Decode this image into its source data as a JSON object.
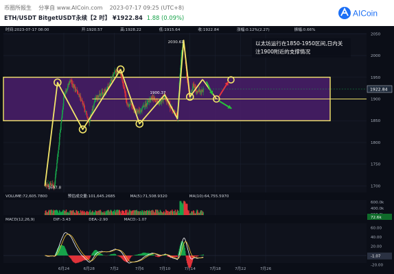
{
  "header": {
    "source": "币圈所报生",
    "share": "分享自 www.AICoin.com",
    "datetime": "2023-07-17 09:25 (UTC+8)",
    "pair": "ETH/USDT BitgetUSDT永续【2 时】",
    "price": "¥1922.84",
    "change": "1.88 (0.09%)",
    "brand": "AICoin"
  },
  "colors": {
    "up": "#17a34a",
    "down": "#e0333a",
    "annotation": "#f4e66a",
    "zone_fill": "#4a1e6b",
    "current_price": "#1f2a3a"
  },
  "ohlc_bar": [
    "时间:2023-07-17 08:00",
    "开:1920.57",
    "高:1928.22",
    "低:1915.64",
    "收:1922.84",
    "涨幅:0.12%(2.27)",
    "振幅:0.66%"
  ],
  "chart_data": [
    {
      "type": "candlestick",
      "title": "ETH/USDT BitgetUSDT永续 2时",
      "x_ticks": [
        "6月24",
        "6月28",
        "7月2",
        "7月6",
        "7月10",
        "7月14",
        "7月18",
        "7月22",
        "7月26"
      ],
      "y_ticks": [
        2050,
        2000,
        1950,
        1900,
        1850,
        1800,
        1750,
        1700
      ],
      "ylim": [
        1685,
        2052
      ],
      "current_price": "1922.84",
      "price_labels": [
        "2030.61",
        "1900.37",
        "1697.8"
      ],
      "zone": {
        "low": 1850,
        "high": 1950
      },
      "zigzag_path": [
        [
          "6月21",
          1700
        ],
        [
          "6月23",
          1938
        ],
        [
          "6月27",
          1830
        ],
        [
          "7月3",
          1968
        ],
        [
          "7月6",
          1843
        ],
        [
          "7月10",
          1910
        ],
        [
          "7月12",
          1855
        ],
        [
          "7月13",
          2035
        ],
        [
          "7月14",
          1905
        ],
        [
          "7月16",
          1945
        ]
      ],
      "support_level": 1900,
      "annotation": [
        "以太坊运行在1850-1950区间,日内关",
        "注1900附近的支撑情况"
      ]
    },
    {
      "type": "bar",
      "title": "VOLUME",
      "legend": [
        "VOLUME:72,605.7800",
        "预估成交量:101,645.2685",
        "MA(5):71,508.9320",
        "MA(10):64,755.5970"
      ],
      "y_ticks": [
        "600.0k",
        "400.0k",
        "200.0k"
      ],
      "last_value": "72.6k"
    },
    {
      "type": "line",
      "title": "MACD(12,26,9)",
      "legend": [
        "MACD(12,26,9)",
        "DIF:-3.43",
        "DEA:-2.90",
        "MACD:-1.07"
      ],
      "y_ticks": [
        "60.00",
        "40.00",
        "20.00",
        "0.00",
        "-20.00"
      ],
      "last_value": "-1.07"
    }
  ]
}
